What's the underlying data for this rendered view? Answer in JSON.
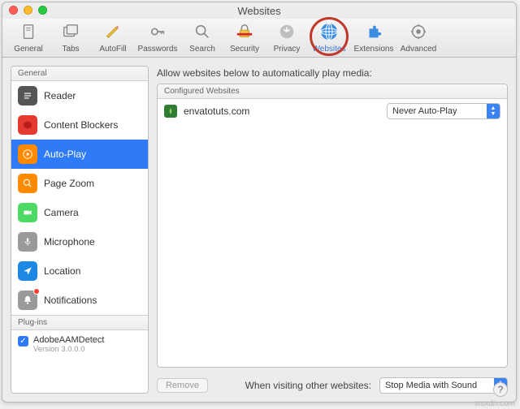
{
  "window": {
    "title": "Websites"
  },
  "toolbar": {
    "items": [
      {
        "label": "General"
      },
      {
        "label": "Tabs"
      },
      {
        "label": "AutoFill"
      },
      {
        "label": "Passwords"
      },
      {
        "label": "Search"
      },
      {
        "label": "Security"
      },
      {
        "label": "Privacy"
      },
      {
        "label": "Websites"
      },
      {
        "label": "Extensions"
      },
      {
        "label": "Advanced"
      }
    ]
  },
  "sidebar": {
    "general_header": "General",
    "items": [
      {
        "label": "Reader"
      },
      {
        "label": "Content Blockers"
      },
      {
        "label": "Auto-Play"
      },
      {
        "label": "Page Zoom"
      },
      {
        "label": "Camera"
      },
      {
        "label": "Microphone"
      },
      {
        "label": "Location"
      },
      {
        "label": "Notifications"
      }
    ],
    "plugins_header": "Plug-ins",
    "plugin": {
      "name": "AdobeAAMDetect",
      "version": "Version 3.0.0.0",
      "enabled": true
    }
  },
  "main": {
    "heading": "Allow websites below to automatically play media:",
    "configured_header": "Configured Websites",
    "rows": [
      {
        "site": "envatotuts.com",
        "policy": "Never Auto-Play"
      }
    ],
    "remove_label": "Remove",
    "other_label": "When visiting other websites:",
    "other_value": "Stop Media with Sound"
  },
  "watermark": "wsxdn.com"
}
